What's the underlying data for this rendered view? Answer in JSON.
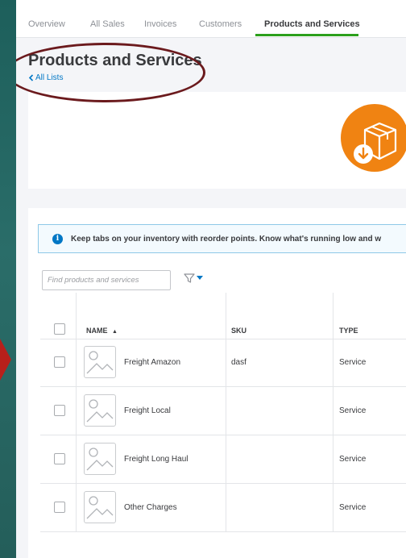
{
  "tabs": [
    {
      "label": "Overview"
    },
    {
      "label": "All Sales"
    },
    {
      "label": "Invoices"
    },
    {
      "label": "Customers"
    },
    {
      "label": "Products and Services"
    }
  ],
  "page": {
    "title": "Products and Services",
    "back_link": "All Lists",
    "back_icon": "chevron-left-icon"
  },
  "hero": {
    "icon": "box-download-icon",
    "accent_color": "#f08312"
  },
  "banner": {
    "icon": "info-icon",
    "text": "Keep tabs on your inventory with reorder points. Know what's running low and w"
  },
  "search": {
    "placeholder": "Find products and services",
    "value": ""
  },
  "filter": {
    "icon": "filter-icon",
    "dropdown_icon": "caret-down-icon"
  },
  "table": {
    "columns": {
      "name": "NAME",
      "sort_indicator": "▲",
      "sku": "SKU",
      "type": "TYPE"
    },
    "rows": [
      {
        "name": "Freight Amazon",
        "sku": "dasf",
        "type": "Service"
      },
      {
        "name": "Freight Local",
        "sku": "",
        "type": "Service"
      },
      {
        "name": "Freight Long Haul",
        "sku": "",
        "type": "Service"
      },
      {
        "name": "Other Charges",
        "sku": "",
        "type": "Service"
      }
    ]
  },
  "colors": {
    "active_tab_underline": "#2ca01c",
    "link": "#0077c5",
    "annotation_oval": "#6b1a1d",
    "annotation_arrow": "#b8201b"
  }
}
